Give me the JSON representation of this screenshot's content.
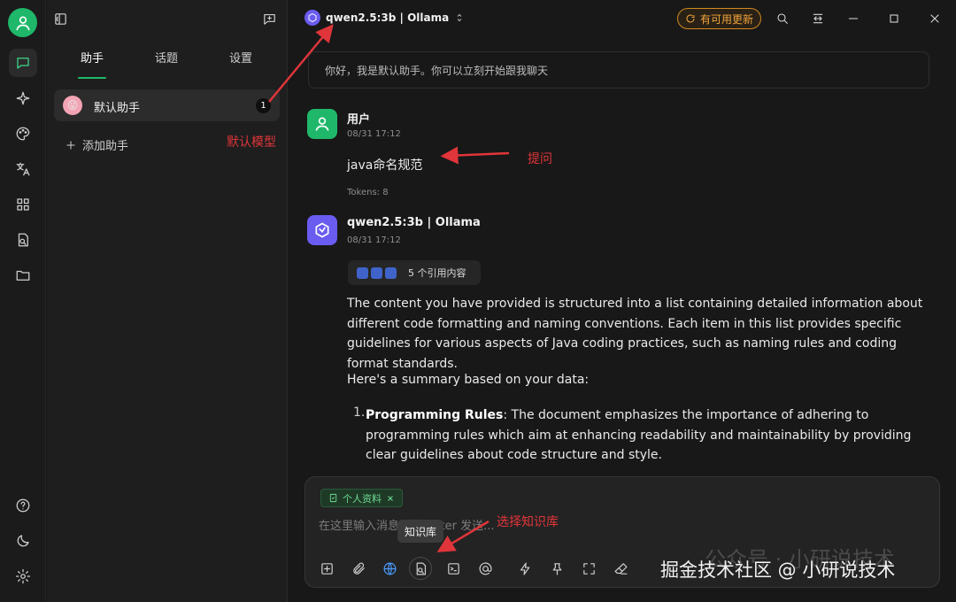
{
  "sidebar": {
    "tabs": [
      "助手",
      "话题",
      "设置"
    ],
    "assistant": {
      "name": "默认助手",
      "count": "1",
      "emoji": "😜"
    },
    "add_assistant": "添加助手"
  },
  "header": {
    "model": "qwen2.5:3b | Ollama",
    "update_label": "有可用更新"
  },
  "chat": {
    "greeting": "你好，我是默认助手。你可以立刻开始跟我聊天",
    "user": {
      "name": "用户",
      "time": "08/31 17:12",
      "text": "java命名规范",
      "tokens": "Tokens: 8"
    },
    "assistant": {
      "name": "qwen2.5:3b | Ollama",
      "time": "08/31 17:12",
      "refs_label": "5 个引用内容",
      "p1": "The content you have provided is structured into a list containing detailed information about different code formatting and naming conventions. Each item in this list provides specific guidelines for various aspects of Java coding practices, such as naming rules and coding format standards.",
      "p2": "Here's a summary based on your data:",
      "item1_num": "1.",
      "item1_title": "Programming Rules",
      "item1_text": ": The document emphasizes the importance of adhering to programming rules which aim at enhancing readability and maintainability by providing clear guidelines about code structure and style."
    }
  },
  "input": {
    "kb_tag": "个人资料",
    "placeholder": "在这里输入消息，按 Enter 发送...",
    "tooltip": "知识库"
  },
  "annotations": {
    "default_model": "默认模型",
    "question": "提问",
    "select_kb": "选择知识库"
  },
  "watermark": "掘金技术社区 @ 小研说技术",
  "watermark_faint": "公众号 · 小研说技术",
  "colors": {
    "accent": "#1fb86a",
    "annotation": "#e0353a",
    "update": "#f0a43a"
  }
}
